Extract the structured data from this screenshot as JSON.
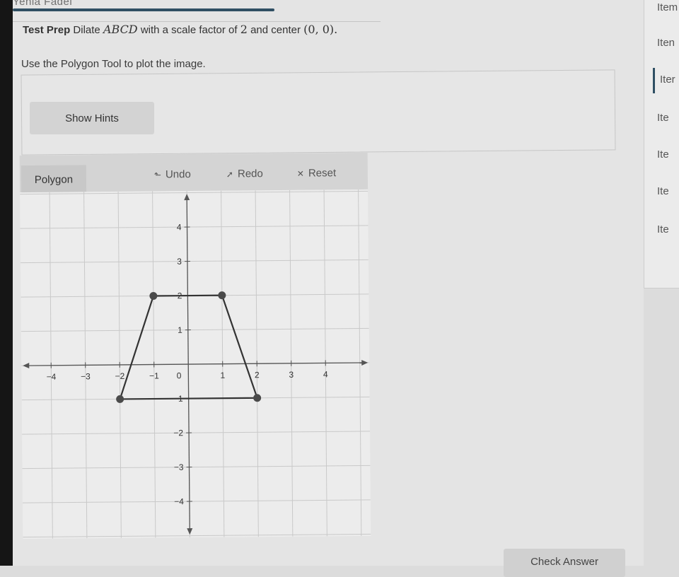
{
  "header": {
    "user_name": "Yehia Fadel"
  },
  "question": {
    "prefix": "Test Prep",
    "text_before": "Dilate",
    "figure_name": "ABCD",
    "text_middle": "with a scale factor of",
    "scale_factor": "2",
    "text_after": "and center",
    "center": "(0, 0)",
    "period": "."
  },
  "instruction": "Use the Polygon Tool to plot the image.",
  "hints": {
    "button_label": "Show Hints"
  },
  "toolbar": {
    "polygon_label": "Polygon",
    "undo_label": "Undo",
    "redo_label": "Redo",
    "reset_label": "Reset",
    "undo_icon": "undo-arrow-icon",
    "redo_icon": "redo-arrow-icon",
    "reset_icon": "close-x-icon"
  },
  "graph": {
    "x_range": [
      -5,
      5
    ],
    "y_range": [
      -5,
      5
    ],
    "x_ticks": [
      -4,
      -3,
      -2,
      -1,
      1,
      2,
      3,
      4
    ],
    "y_ticks": [
      -4,
      -3,
      -2,
      -1,
      1,
      2,
      3,
      4
    ],
    "origin_label": "0",
    "polygon_points": [
      [
        -2,
        -1
      ],
      [
        -1,
        2
      ],
      [
        1,
        2
      ],
      [
        2,
        -1
      ]
    ],
    "line_color": "#333333",
    "point_color": "#4a4a4a",
    "grid_color": "#c9c9c9"
  },
  "sidebar": {
    "items": [
      {
        "label": "Item",
        "active": false
      },
      {
        "label": "Iten",
        "active": false
      },
      {
        "label": "Iter",
        "active": true
      },
      {
        "label": "Ite",
        "active": false
      },
      {
        "label": "Ite",
        "active": false
      },
      {
        "label": "Ite",
        "active": false
      },
      {
        "label": "Ite",
        "active": false
      }
    ]
  },
  "footer": {
    "check_answer_label": "Check Answer"
  }
}
